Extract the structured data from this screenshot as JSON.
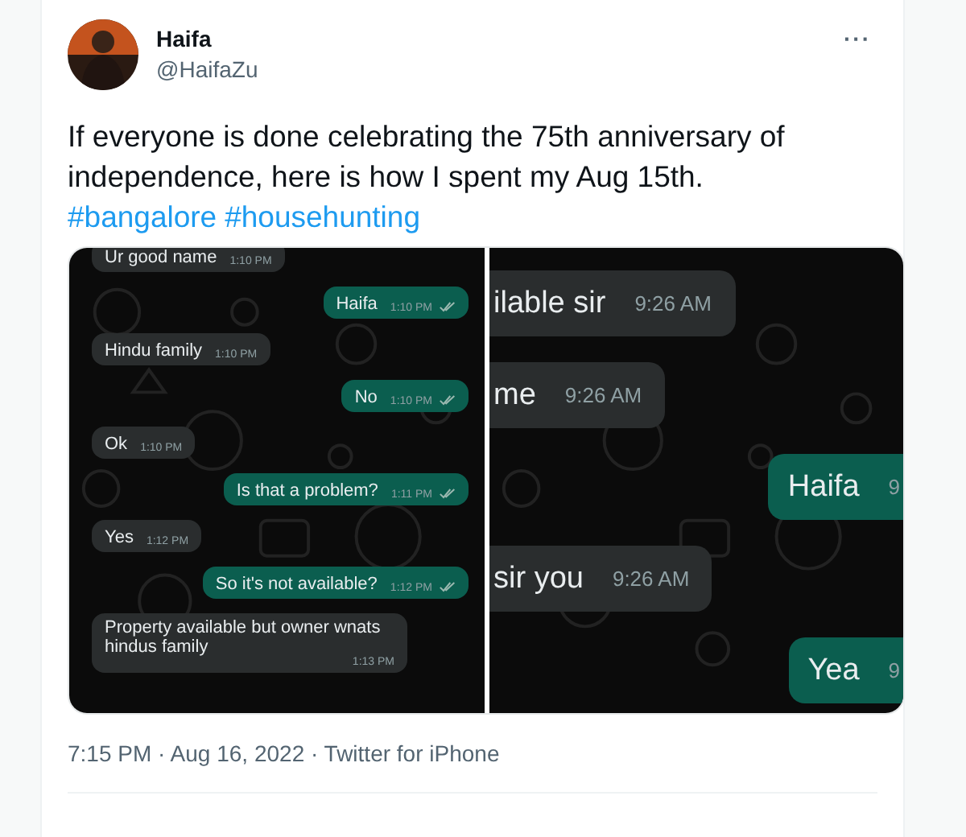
{
  "tweet": {
    "author": {
      "name": "Haifa",
      "handle": "@HaifaZu"
    },
    "more_button": "···",
    "text": "If everyone is done celebrating the 75th anniversary of independence, here is how I spent my Aug 15th.",
    "hashtags": [
      "#bangalore",
      "#househunting"
    ],
    "images": [
      {
        "kind": "small",
        "messages": [
          {
            "text": "Ur good name",
            "time": "1:10 PM",
            "kind": "received"
          },
          {
            "text": "Haifa",
            "time": "1:10 PM",
            "kind": "sent",
            "ticks": true
          },
          {
            "text": "Hindu family",
            "time": "1:10 PM",
            "kind": "received"
          },
          {
            "text": "No",
            "time": "1:10 PM",
            "kind": "sent",
            "ticks": true
          },
          {
            "text": "Ok",
            "time": "1:10 PM",
            "kind": "received"
          },
          {
            "text": "Is that a problem?",
            "time": "1:11 PM",
            "kind": "sent",
            "ticks": true
          },
          {
            "text": "Yes",
            "time": "1:12 PM",
            "kind": "received"
          },
          {
            "text": "So it's not available?",
            "time": "1:12 PM",
            "kind": "sent",
            "ticks": true
          },
          {
            "text": "Property available but owner wnats hindus family",
            "time": "1:13 PM",
            "kind": "received"
          }
        ]
      },
      {
        "kind": "zoomed",
        "messages": [
          {
            "text": "ilable sir",
            "time": "9:26 AM",
            "kind": "received"
          },
          {
            "text": "me",
            "time": "9:26 AM",
            "kind": "received"
          },
          {
            "text": "Haifa",
            "time": "9",
            "kind": "sent"
          },
          {
            "text": "sir you",
            "time": "9:26 AM",
            "kind": "received"
          },
          {
            "text": "Yea",
            "time": "9",
            "kind": "sent"
          }
        ]
      }
    ],
    "timestamp": "7:15 PM · Aug 16, 2022 · Twitter for iPhone"
  }
}
